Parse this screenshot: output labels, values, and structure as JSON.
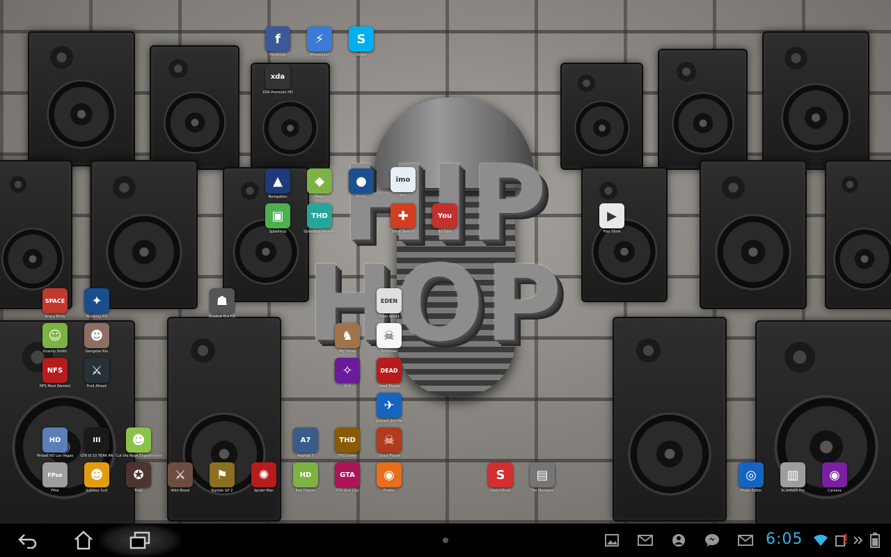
{
  "colors": {
    "clock": "#33b5e5",
    "system_bar": "#000000",
    "facebook": "#3b5998",
    "messenger": "#3c7ad6",
    "skype": "#00aff0",
    "youtube_red": "#c4302b"
  },
  "wallpaper": {
    "logo_line1": "HIP",
    "logo_line2": "HOP"
  },
  "apps": [
    {
      "id": "facebook",
      "label": "Facebook",
      "icon": "facebook-icon",
      "glyph": "f"
    },
    {
      "id": "messenger",
      "label": "Messenger",
      "icon": "messenger-icon",
      "glyph": "⚡"
    },
    {
      "id": "skype",
      "label": "Skype",
      "icon": "skype-icon",
      "glyph": "S"
    },
    {
      "id": "xda",
      "label": "XDA Premium HD",
      "icon": "xda-icon",
      "glyph": "xda"
    },
    {
      "id": "navigation",
      "label": "Navigation",
      "icon": "navigation-icon",
      "glyph": "▲"
    },
    {
      "id": "maps",
      "label": "Maps",
      "icon": "maps-icon",
      "glyph": "◆"
    },
    {
      "id": "earth",
      "label": "Earth",
      "icon": "earth-icon",
      "glyph": "●"
    },
    {
      "id": "imo",
      "label": "imo",
      "icon": "imo-icon",
      "glyph": "imo"
    },
    {
      "id": "splashtop",
      "label": "Splashtop",
      "icon": "splashtop-icon",
      "glyph": "▣"
    },
    {
      "id": "splashtop-thd",
      "label": "Splashtop Remote",
      "icon": "splashtop-thd-icon",
      "glyph": "THD"
    },
    {
      "id": "voice-search",
      "label": "Voice Search",
      "icon": "voice-search-icon",
      "glyph": "✚"
    },
    {
      "id": "youtube",
      "label": "YouTube",
      "icon": "youtube-icon",
      "glyph": "You"
    },
    {
      "id": "play-store",
      "label": "Play Store",
      "icon": "play-store-icon",
      "glyph": "▶"
    },
    {
      "id": "angry-birds-space",
      "label": "Angry Birds",
      "icon": "angry-birds-space-icon",
      "glyph": "SPACE"
    },
    {
      "id": "alchemy",
      "label": "Alchemy HD",
      "icon": "alchemy-icon",
      "glyph": "✦"
    },
    {
      "id": "shadow-era",
      "label": "Shadow Era HD",
      "icon": "shadow-era-icon",
      "glyph": "☗"
    },
    {
      "id": "eden-world",
      "label": "Eden World",
      "icon": "eden-world-icon",
      "glyph": "EDEN"
    },
    {
      "id": "granny-smith",
      "label": "Granny Smith",
      "icon": "granny-smith-icon",
      "glyph": "☺"
    },
    {
      "id": "gangstar-rio",
      "label": "Gangstar Rio",
      "icon": "gangstar-rio-icon",
      "glyph": "☻"
    },
    {
      "id": "my-horse",
      "label": "My Horse",
      "icon": "my-horse-icon",
      "glyph": "♞"
    },
    {
      "id": "stickman",
      "label": "Stickman",
      "icon": "stickman-icon",
      "glyph": "☠"
    },
    {
      "id": "nfs",
      "label": "NFS Most Wanted",
      "icon": "nfs-icon",
      "glyph": "NFS"
    },
    {
      "id": "fruit-attack",
      "label": "Fruit Attack",
      "icon": "fruit-attack-icon",
      "glyph": "⚔"
    },
    {
      "id": "vlc",
      "label": "VLA",
      "icon": "purple-game-icon",
      "glyph": "✧"
    },
    {
      "id": "dead-trigger",
      "label": "Dead Trigger",
      "icon": "dead-trigger-icon",
      "glyph": "DEAD"
    },
    {
      "id": "jetpack",
      "label": "Jetpack Joyride",
      "icon": "jetpack-icon",
      "glyph": "✈"
    },
    {
      "id": "pinball",
      "label": "Pinball HD Las Vegas",
      "icon": "pinball-icon",
      "glyph": "HD"
    },
    {
      "id": "gta3",
      "label": "GTA III 10 YEAR AN",
      "icon": "gta3-icon",
      "glyph": "III"
    },
    {
      "id": "cut-the-rope",
      "label": "Cut the Rope Experiments",
      "icon": "cut-the-rope-icon",
      "glyph": "☻"
    },
    {
      "id": "asphalt",
      "label": "Asphalt 7",
      "icon": "asphalt-icon",
      "glyph": "A7"
    },
    {
      "id": "tiny-thd",
      "label": "THD Game",
      "icon": "thd-game-icon",
      "glyph": "THD"
    },
    {
      "id": "ghost-player",
      "label": "Ghost Player",
      "icon": "ghost-icon",
      "glyph": "☠"
    },
    {
      "id": "fpse",
      "label": "FPse",
      "icon": "fpse-icon",
      "glyph": "FPse"
    },
    {
      "id": "subway-surf",
      "label": "Subway Surf",
      "icon": "subway-surf-icon",
      "glyph": "☻"
    },
    {
      "id": "trials",
      "label": "Trials",
      "icon": "trials-icon",
      "glyph": "✪"
    },
    {
      "id": "wild-blood",
      "label": "Wild Blood",
      "icon": "wild-blood-icon",
      "glyph": "⚔"
    },
    {
      "id": "riptide",
      "label": "Riptide GP 2",
      "icon": "riptide-icon",
      "glyph": "⚑"
    },
    {
      "id": "spider-man",
      "label": "Spider-Man",
      "icon": "spider-man-icon",
      "glyph": "✺"
    },
    {
      "id": "bad-piggies",
      "label": "Bad Piggies",
      "icon": "bad-piggies-icon",
      "glyph": "HD"
    },
    {
      "id": "gta-vc",
      "label": "GTA Vice City",
      "icon": "gta-vc-icon",
      "glyph": "GTA"
    },
    {
      "id": "firefox",
      "label": "Firefox",
      "icon": "firefox-icon",
      "glyph": "◉"
    },
    {
      "id": "sketchbook",
      "label": "SketchBook",
      "icon": "sketchbook-icon",
      "glyph": "S"
    },
    {
      "id": "file-manager",
      "label": "File Manager",
      "icon": "file-manager-icon",
      "glyph": "▤"
    },
    {
      "id": "photo-editor",
      "label": "Photo Editor",
      "icon": "photo-editor-icon",
      "glyph": "◎"
    },
    {
      "id": "scanner",
      "label": "SCANNER Pro",
      "icon": "scanner-icon",
      "glyph": "▥"
    },
    {
      "id": "camera",
      "label": "Camera",
      "icon": "camera-icon",
      "glyph": "◉"
    }
  ],
  "system_bar": {
    "clock": "6:05",
    "nav": [
      "back-icon",
      "home-icon",
      "recent-apps-icon"
    ],
    "notifications": [
      "gallery-notification-icon",
      "gmail-notification-icon",
      "account-notification-icon",
      "messenger-notification-icon",
      "email-notification-icon"
    ],
    "status": [
      "wifi-icon",
      "sd-card-warning-icon",
      "more-icon",
      "battery-icon"
    ]
  }
}
